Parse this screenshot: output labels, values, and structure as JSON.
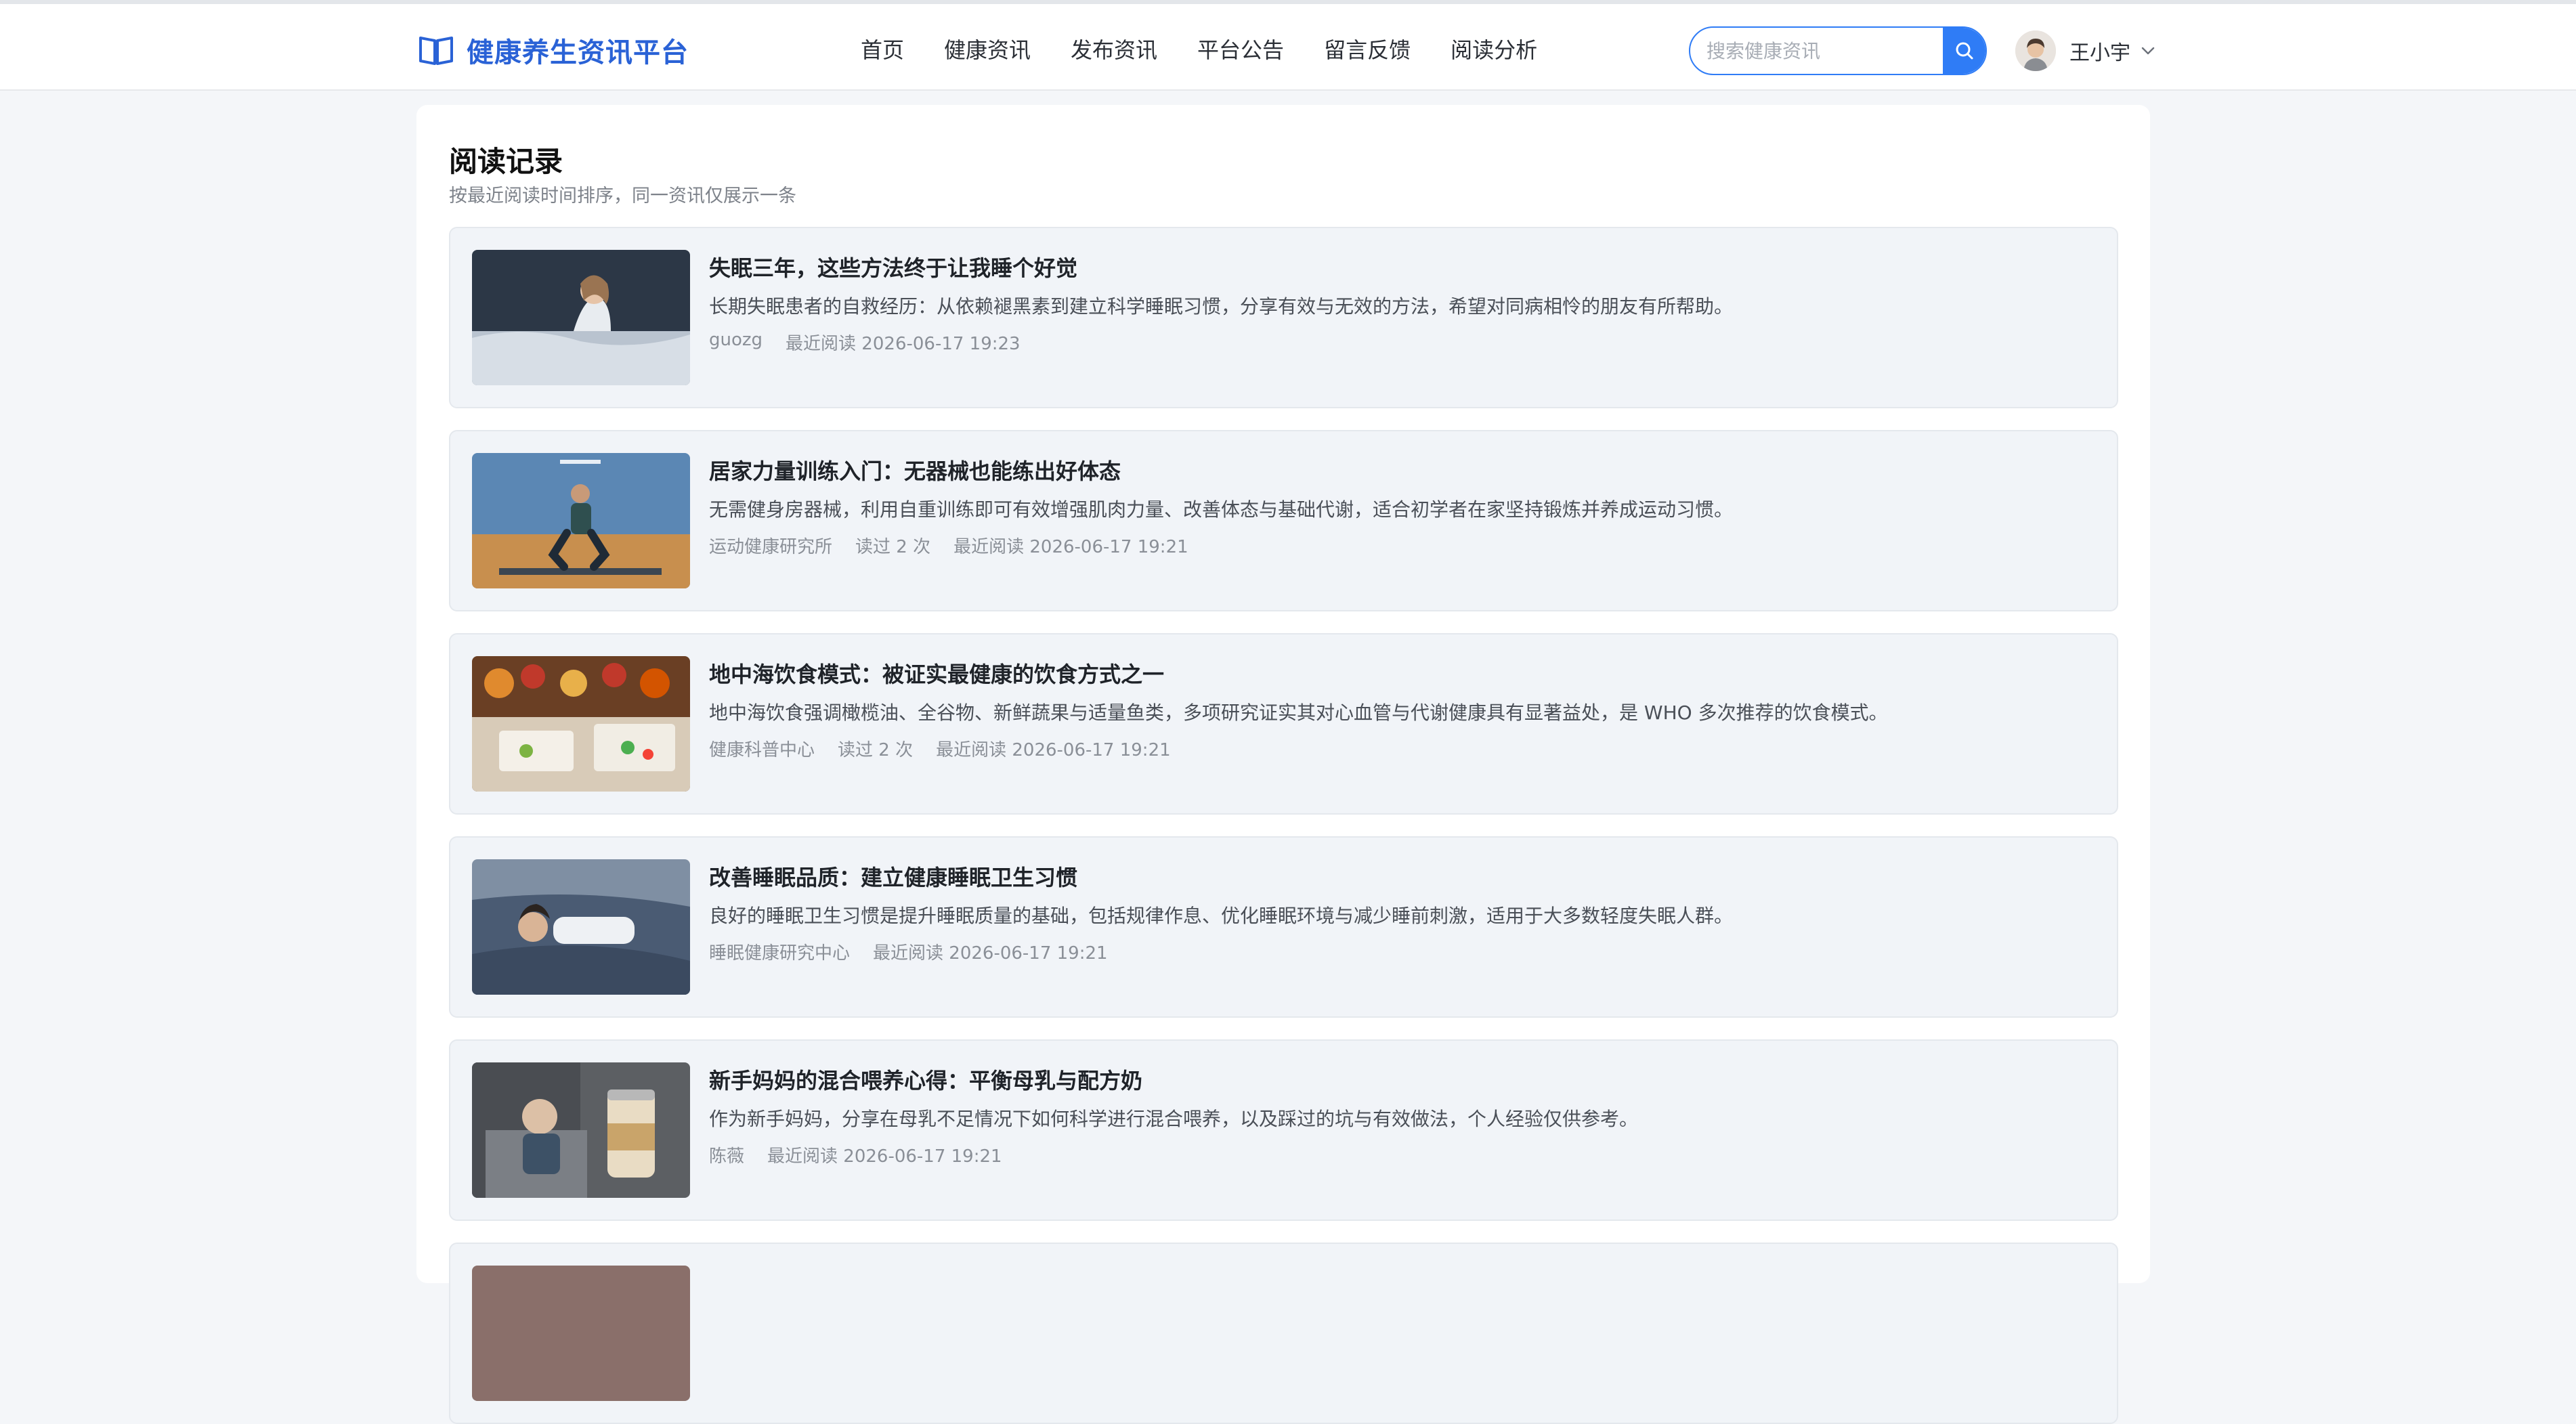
{
  "header": {
    "brand_title": "健康养生资讯平台",
    "nav": [
      "首页",
      "健康资讯",
      "发布资讯",
      "平台公告",
      "留言反馈",
      "阅读分析"
    ],
    "search_placeholder": "搜索健康资讯",
    "user_name": "王小宇",
    "accent_color": "#2f7cf6"
  },
  "page": {
    "title": "阅读记录",
    "subtitle": "按最近阅读时间排序，同一资讯仅展示一条"
  },
  "records": [
    {
      "title": "失眠三年，这些方法终于让我睡个好觉",
      "desc": "长期失眠患者的自救经历：从依赖褪黑素到建立科学睡眠习惯，分享有效与无效的方法，希望对同病相怜的朋友有所帮助。",
      "author": "guozg",
      "read_count": "",
      "last_read": "最近阅读 2026-06-17 19:23"
    },
    {
      "title": "居家力量训练入门：无器械也能练出好体态",
      "desc": "无需健身房器械，利用自重训练即可有效增强肌肉力量、改善体态与基础代谢，适合初学者在家坚持锻炼并养成运动习惯。",
      "author": "运动健康研究所",
      "read_count": "读过 2 次",
      "last_read": "最近阅读 2026-06-17 19:21"
    },
    {
      "title": "地中海饮食模式：被证实最健康的饮食方式之一",
      "desc": "地中海饮食强调橄榄油、全谷物、新鲜蔬果与适量鱼类，多项研究证实其对心血管与代谢健康具有显著益处，是 WHO 多次推荐的饮食模式。",
      "author": "健康科普中心",
      "read_count": "读过 2 次",
      "last_read": "最近阅读 2026-06-17 19:21"
    },
    {
      "title": "改善睡眠品质：建立健康睡眠卫生习惯",
      "desc": "良好的睡眠卫生习惯是提升睡眠质量的基础，包括规律作息、优化睡眠环境与减少睡前刺激，适用于大多数轻度失眠人群。",
      "author": "睡眠健康研究中心",
      "read_count": "",
      "last_read": "最近阅读 2026-06-17 19:21"
    },
    {
      "title": "新手妈妈的混合喂养心得：平衡母乳与配方奶",
      "desc": "作为新手妈妈，分享在母乳不足情况下如何科学进行混合喂养，以及踩过的坑与有效做法，个人经验仅供参考。",
      "author": "陈薇",
      "read_count": "",
      "last_read": "最近阅读 2026-06-17 19:21"
    }
  ]
}
